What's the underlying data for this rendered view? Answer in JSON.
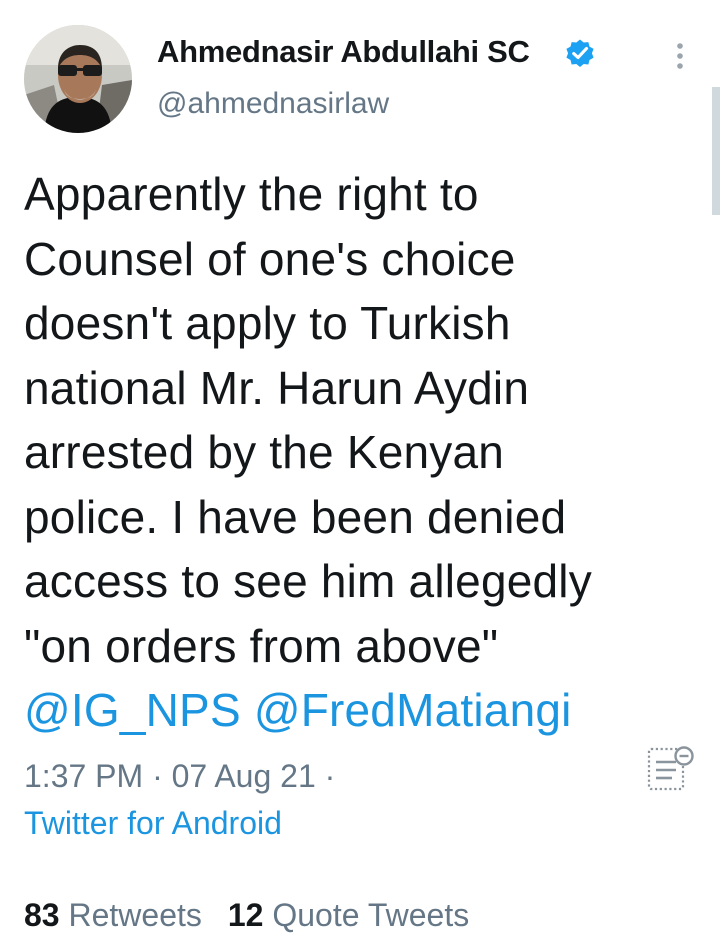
{
  "author": {
    "name": "Ahmednasir Abdullahi SC",
    "handle": "@ahmednasirlaw",
    "verified_color": "#1da1f2"
  },
  "tweet": {
    "lines": [
      "Apparently the right to",
      "Counsel of one's choice",
      "doesn't apply to Turkish",
      "national Mr. Harun Aydin",
      "arrested by the Kenyan",
      "police. I have been denied",
      "access to see him allegedly",
      "\"on orders from above\""
    ],
    "mentions": [
      "@IG_NPS",
      "@FredMatiangi"
    ]
  },
  "meta": {
    "time": "1:37 PM · 07 Aug 21 ·",
    "source": "Twitter for Android"
  },
  "stats": {
    "retweets_count": "83",
    "retweets_label": "Retweets",
    "quotes_count": "12",
    "quotes_label": "Quote Tweets"
  },
  "icons": {
    "verified": "verified-badge-icon",
    "more": "more-vertical-icon",
    "reader": "reader-mode-icon"
  },
  "colors": {
    "link": "#1b95e0",
    "secondary_text": "#657786",
    "primary_text": "#14171a"
  }
}
